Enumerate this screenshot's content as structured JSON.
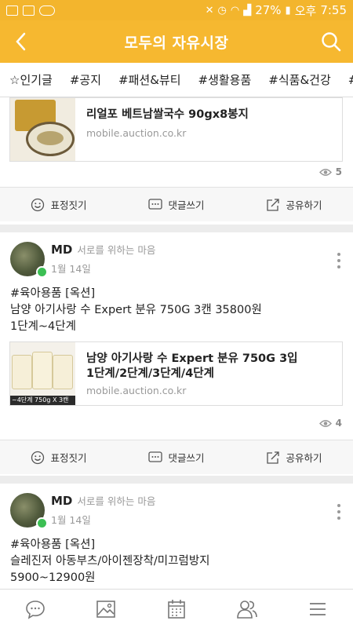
{
  "statusbar": {
    "battery": "27%",
    "ampm": "오후",
    "time": "7:55"
  },
  "header": {
    "title": "모두의 자유시장"
  },
  "categories": [
    "☆인기글",
    "#공지",
    "#패션&뷰티",
    "#생활용품",
    "#식품&건강",
    "#육"
  ],
  "posts": [
    {
      "link_title": "리얼포 베트남쌀국수 90gx8봉지",
      "link_url": "mobile.auction.co.kr",
      "views": "5"
    },
    {
      "author": "MD",
      "author_desc": "서로를 위하는 마음",
      "date": "1월 14일",
      "text_lines": [
        "#육아용품 [옥션]",
        "남양 아기사랑 수 Expert 분유 750G 3캔 35800원",
        "1단계~4단계"
      ],
      "link_title_lines": [
        "남양  아기사랑 수 Expert 분유 750G 3입",
        "1단계/2단계/3단계/4단계"
      ],
      "link_url": "mobile.auction.co.kr",
      "thumb_caption": "~4단계 750g X 3캔",
      "views": "4"
    },
    {
      "author": "MD",
      "author_desc": "서로를 위하는 마음",
      "date": "1월 14일",
      "text_lines": [
        "#육아용품 [옥션]",
        "슬레진저 아동부츠/아이젠장착/미끄럼방지",
        "5900~12900원"
      ]
    }
  ],
  "actions": {
    "emotion": "표정짓기",
    "comment": "댓글쓰기",
    "share": "공유하기"
  },
  "colors": {
    "accent": "#f6b830",
    "badge": "#3cbf54"
  }
}
